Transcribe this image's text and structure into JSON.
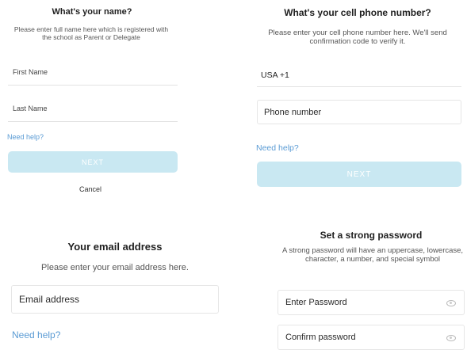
{
  "name_step": {
    "title": "What's your name?",
    "description": "Please enter full name here which is registered with the school as Parent or Delegate",
    "first_name_placeholder": "First Name",
    "last_name_placeholder": "Last Name",
    "help_link": "Need help?",
    "next_button": "NEXT",
    "cancel_button": "Cancel"
  },
  "phone_step": {
    "title": "What's your cell phone number?",
    "description": "Please enter your cell phone number here. We'll send confirmation code to verify it.",
    "country_code": "USA +1",
    "phone_placeholder": "Phone number",
    "help_link": "Need help?",
    "next_button": "NEXT"
  },
  "email_step": {
    "title": "Your email address",
    "description": "Please enter your email address here.",
    "email_placeholder": "Email address",
    "help_link": "Need help?"
  },
  "password_step": {
    "title": "Set a strong password",
    "description": "A strong password will have an uppercase, lowercase, character, a number, and special symbol",
    "password_placeholder": "Enter Password",
    "confirm_placeholder": "Confirm password"
  },
  "colors": {
    "accent_link": "#5a9bd4",
    "button_disabled": "#c9e8f2"
  }
}
